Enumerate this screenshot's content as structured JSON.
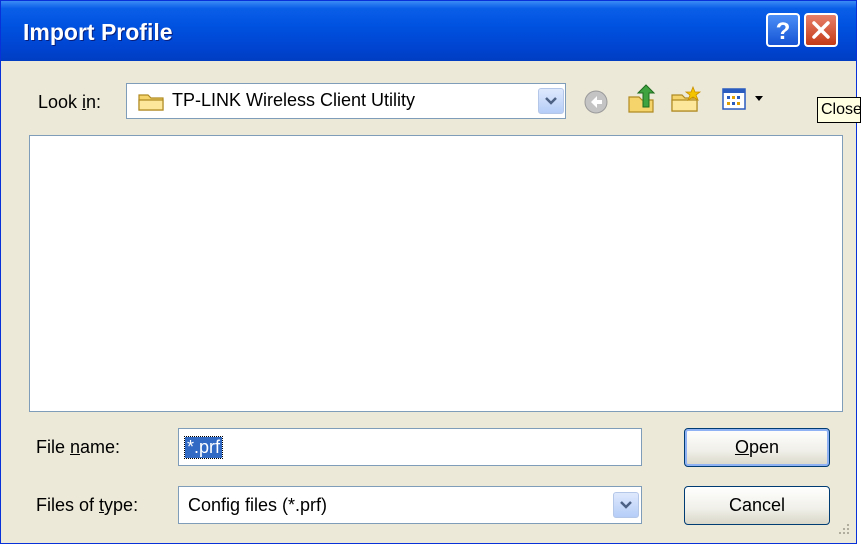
{
  "dialog": {
    "title": "Import Profile",
    "help_glyph": "?",
    "close_glyph": "×"
  },
  "look_in": {
    "label_pre": "Look ",
    "label_accel": "i",
    "label_post": "n:",
    "value": "TP-LINK Wireless Client Utility",
    "folder_icon": "folder-icon"
  },
  "toolbar": {
    "back_icon": "back-icon",
    "up_icon": "up-folder-icon",
    "new_folder_icon": "new-folder-icon",
    "views_icon": "views-menu-icon"
  },
  "tooltip": {
    "text": "Close"
  },
  "file_name": {
    "label_pre": "File ",
    "label_accel": "n",
    "label_post": "ame:",
    "value": "*.prf"
  },
  "files_of_type": {
    "label_pre": "Files of ",
    "label_accel": "t",
    "label_post": "ype:",
    "value": "Config files (*.prf)"
  },
  "buttons": {
    "open_accel": "O",
    "open_rest": "pen",
    "cancel": "Cancel"
  },
  "colors": {
    "title_bar": "#0052e0",
    "dialog_bg": "#ece9d8",
    "selection": "#316ac5"
  }
}
